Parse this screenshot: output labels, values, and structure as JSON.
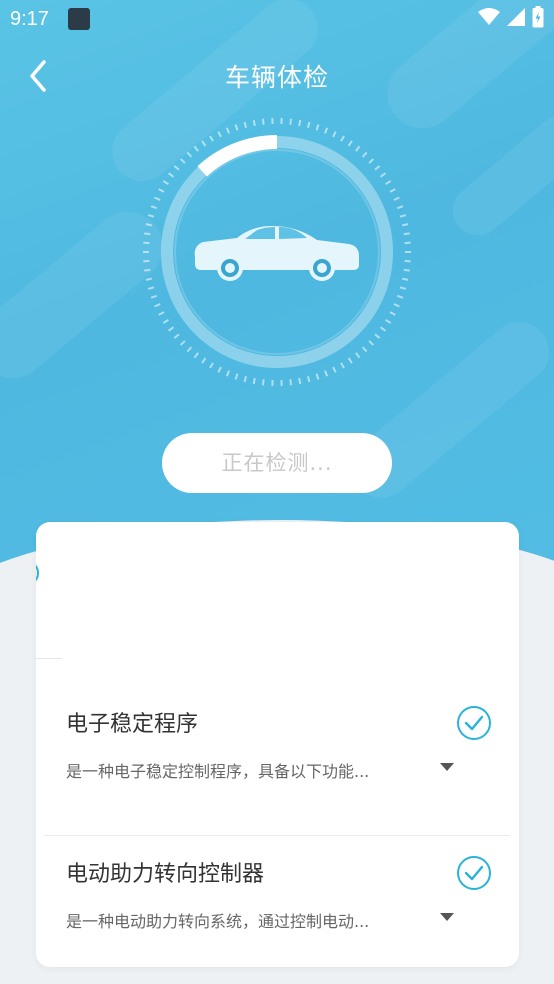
{
  "status_bar": {
    "time": "9:17"
  },
  "header": {
    "title": "车辆体检"
  },
  "scan": {
    "status_text": "正在检测..."
  },
  "colors": {
    "accent": "#2ab3d9",
    "hero": "#4fb8e0"
  },
  "items": [
    {
      "name": "电子稳定程序",
      "desc": "是一种电子稳定控制程序，具备以下功能...",
      "checked": true
    },
    {
      "name": "电动助力转向控制器",
      "desc": "是一种电动助力转向系统，通过控制电动...",
      "checked": true
    }
  ],
  "icons": [
    "back-arrow-icon",
    "car-icon",
    "check-circle-icon",
    "caret-down-icon",
    "wifi-icon",
    "signal-icon",
    "battery-icon"
  ]
}
